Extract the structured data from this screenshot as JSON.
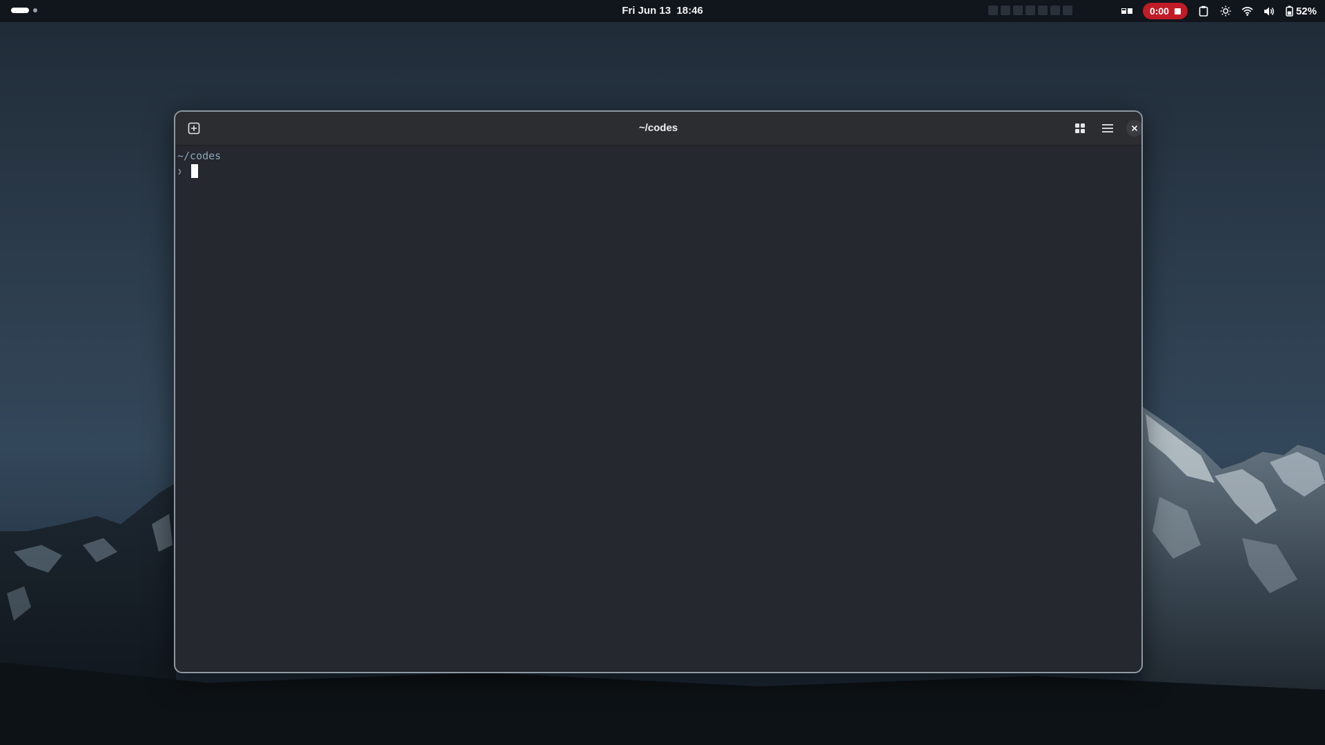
{
  "topbar": {
    "clock_date": "Fri Jun 13",
    "clock_time": "18:46",
    "recording_time": "0:00",
    "battery_percent": "52%",
    "icons": [
      "workspace-switcher-icon",
      "clipboard-icon",
      "brightness-icon",
      "wifi-icon",
      "volume-icon",
      "battery-icon"
    ]
  },
  "terminal": {
    "title": "~/codes",
    "cwd": "~/codes",
    "prompt": "❯"
  },
  "colors": {
    "topbar_bg": "#11161d",
    "recording_red": "#c01c28",
    "terminal_bg": "#25282e",
    "headerbar_bg": "#2b2d31",
    "window_border": "#8e99a3"
  }
}
